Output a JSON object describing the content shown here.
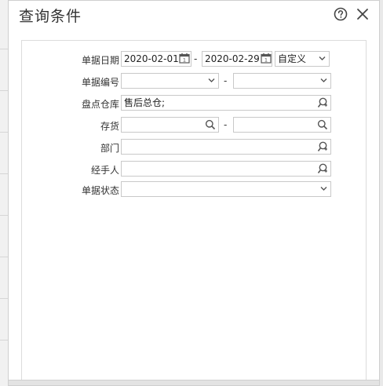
{
  "dialog": {
    "title": "查询条件",
    "help_icon": "help-circle-icon",
    "close_icon": "close-icon"
  },
  "form": {
    "date": {
      "label": "单据日期",
      "start": "2020-02-01",
      "end": "2020-02-29",
      "separator": "-",
      "range_option": "自定义"
    },
    "doc_no": {
      "label": "单据编号",
      "start": "",
      "end": "",
      "separator": "-"
    },
    "warehouse": {
      "label": "盘点仓库",
      "value": "售后总仓;"
    },
    "inventory": {
      "label": "存货",
      "start": "",
      "end": "",
      "separator": "-"
    },
    "department": {
      "label": "部门",
      "value": ""
    },
    "handler": {
      "label": "经手人",
      "value": ""
    },
    "status": {
      "label": "单据状态",
      "value": ""
    }
  },
  "colors": {
    "border": "#c9c9c9",
    "icon": "#555555",
    "text": "#333333"
  }
}
